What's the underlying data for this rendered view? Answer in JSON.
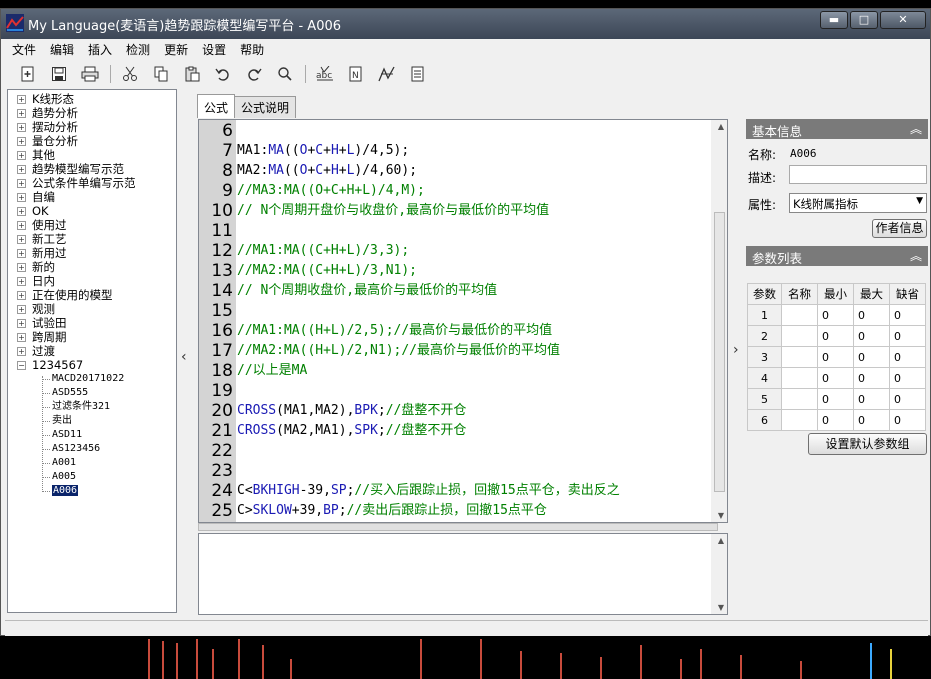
{
  "window": {
    "title": "My Language(麦语言)趋势跟踪模型编写平台 - A006"
  },
  "menu": [
    "文件",
    "编辑",
    "插入",
    "检测",
    "更新",
    "设置",
    "帮助"
  ],
  "toolbar": [
    "new-icon",
    "save-icon",
    "print-icon",
    "cut-icon",
    "copy-icon",
    "paste-icon",
    "undo-icon",
    "redo-icon",
    "find-icon",
    "spellcheck-icon",
    "function-icon",
    "indicator-icon",
    "document-icon"
  ],
  "tree": {
    "groups": [
      "K线形态",
      "趋势分析",
      "摆动分析",
      "量仓分析",
      "其他",
      "趋势模型编写示范",
      "公式条件单编写示范",
      "自编",
      "OK",
      "使用过",
      "新工艺",
      "新用过",
      "新的",
      "日内",
      "正在使用的模型",
      "观测",
      "试验田",
      "跨周期",
      "过渡"
    ],
    "expanded_group": "1234567",
    "children": [
      "MACD20171022",
      "ASD555",
      "过滤条件321",
      "卖出",
      "ASD11",
      "AS123456",
      "A001",
      "A005",
      "A006"
    ],
    "selected": "A006"
  },
  "tabs": [
    "公式",
    "公式说明"
  ],
  "code_lines": [
    {
      "n": "6",
      "parts": []
    },
    {
      "n": "7",
      "parts": [
        [
          "t",
          "MA1:"
        ],
        [
          "k",
          "MA"
        ],
        [
          "t",
          "(("
        ],
        [
          "k",
          "O"
        ],
        [
          "t",
          "+"
        ],
        [
          "k",
          "C"
        ],
        [
          "t",
          "+"
        ],
        [
          "k",
          "H"
        ],
        [
          "t",
          "+"
        ],
        [
          "k",
          "L"
        ],
        [
          "t",
          ")/4,5);"
        ]
      ]
    },
    {
      "n": "8",
      "parts": [
        [
          "t",
          "MA2:"
        ],
        [
          "k",
          "MA"
        ],
        [
          "t",
          "(("
        ],
        [
          "k",
          "O"
        ],
        [
          "t",
          "+"
        ],
        [
          "k",
          "C"
        ],
        [
          "t",
          "+"
        ],
        [
          "k",
          "H"
        ],
        [
          "t",
          "+"
        ],
        [
          "k",
          "L"
        ],
        [
          "t",
          ")/4,60);"
        ]
      ]
    },
    {
      "n": "9",
      "parts": [
        [
          "c",
          "//MA3:MA((O+C+H+L)/4,M);"
        ]
      ]
    },
    {
      "n": "10",
      "parts": [
        [
          "c",
          "// N个周期开盘价与收盘价,最高价与最低价的平均值"
        ]
      ]
    },
    {
      "n": "11",
      "parts": []
    },
    {
      "n": "12",
      "parts": [
        [
          "c",
          "//MA1:MA((C+H+L)/3,3);"
        ]
      ]
    },
    {
      "n": "13",
      "parts": [
        [
          "c",
          "//MA2:MA((C+H+L)/3,N1);"
        ]
      ]
    },
    {
      "n": "14",
      "parts": [
        [
          "c",
          "// N个周期收盘价,最高价与最低价的平均值"
        ]
      ]
    },
    {
      "n": "15",
      "parts": []
    },
    {
      "n": "16",
      "parts": [
        [
          "c",
          "//MA1:MA((H+L)/2,5);//最高价与最低价的平均值"
        ]
      ]
    },
    {
      "n": "17",
      "parts": [
        [
          "c",
          "//MA2:MA((H+L)/2,N1);//最高价与最低价的平均值"
        ]
      ]
    },
    {
      "n": "18",
      "parts": [
        [
          "c",
          "//以上是MA"
        ]
      ]
    },
    {
      "n": "19",
      "parts": []
    },
    {
      "n": "20",
      "parts": [
        [
          "k",
          "CROSS"
        ],
        [
          "t",
          "(MA1,MA2),"
        ],
        [
          "k",
          "BPK"
        ],
        [
          "t",
          ";"
        ],
        [
          "c",
          "//盘整不开仓"
        ]
      ]
    },
    {
      "n": "21",
      "parts": [
        [
          "k",
          "CROSS"
        ],
        [
          "t",
          "(MA2,MA1),"
        ],
        [
          "k",
          "SPK"
        ],
        [
          "t",
          ";"
        ],
        [
          "c",
          "//盘整不开仓"
        ]
      ]
    },
    {
      "n": "22",
      "parts": []
    },
    {
      "n": "23",
      "parts": []
    },
    {
      "n": "24",
      "parts": [
        [
          "t",
          "C<"
        ],
        [
          "k",
          "BKHIGH"
        ],
        [
          "t",
          "-39,"
        ],
        [
          "k",
          "SP"
        ],
        [
          "t",
          ";"
        ],
        [
          "c",
          "//买入后跟踪止损，回撤15点平仓，卖出反之"
        ]
      ]
    },
    {
      "n": "25",
      "parts": [
        [
          "t",
          "C>"
        ],
        [
          "k",
          "SKLOW"
        ],
        [
          "t",
          "+39,"
        ],
        [
          "k",
          "BP"
        ],
        [
          "t",
          ";"
        ],
        [
          "c",
          "//卖出后跟踪止损，回撤15点平仓"
        ]
      ]
    }
  ],
  "info": {
    "header": "基本信息",
    "name_label": "名称:",
    "name_value": "A006",
    "desc_label": "描述:",
    "desc_value": "",
    "attr_label": "属性:",
    "attr_value": "K线附属指标",
    "author_button": "作者信息"
  },
  "params": {
    "header": "参数列表",
    "columns": [
      "参数",
      "名称",
      "最小",
      "最大",
      "缺省"
    ],
    "rows": [
      [
        "1",
        "",
        "0",
        "0",
        "0"
      ],
      [
        "2",
        "",
        "0",
        "0",
        "0"
      ],
      [
        "3",
        "",
        "0",
        "0",
        "0"
      ],
      [
        "4",
        "",
        "0",
        "0",
        "0"
      ],
      [
        "5",
        "",
        "0",
        "0",
        "0"
      ],
      [
        "6",
        "",
        "0",
        "0",
        "0"
      ]
    ],
    "default_button": "设置默认参数组"
  },
  "colors": {
    "keyword": "#1a1ab4",
    "comment": "#008000",
    "selection": "#0a246a",
    "panel_header": "#7a7a7a"
  }
}
